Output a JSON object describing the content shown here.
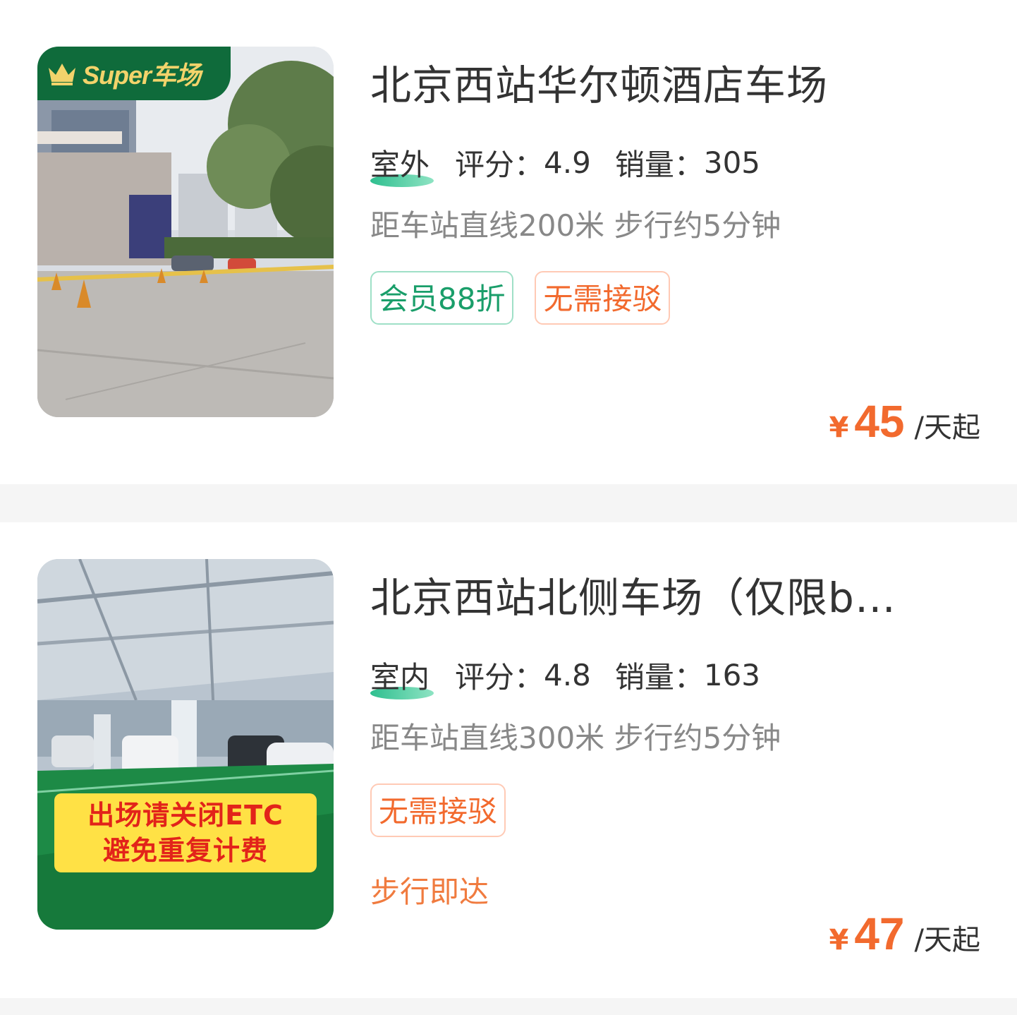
{
  "listings": [
    {
      "badge": "Super车场",
      "title": "北京西站华尔顿酒店车场",
      "environment": "室外",
      "rating_label": "评分：",
      "rating": "4.9",
      "sales_label": "销量：",
      "sales": "305",
      "distance": "距车站直线200米 步行约5分钟",
      "tags": [
        "会员88折",
        "无需接驳"
      ],
      "price_currency": "¥",
      "price": "45",
      "price_unit": "/天起"
    },
    {
      "title": "北京西站北侧车场（仅限b…",
      "image_banner": [
        "出场请关闭ETC",
        "避免重复计费"
      ],
      "environment": "室内",
      "rating_label": "评分：",
      "rating": "4.8",
      "sales_label": "销量：",
      "sales": "163",
      "distance": "距车站直线300米 步行约5分钟",
      "tags": [
        "无需接驳"
      ],
      "walk_note": "步行即达",
      "price_currency": "¥",
      "price": "47",
      "price_unit": "/天起"
    }
  ],
  "colors": {
    "accent_orange": "#f26a2e",
    "accent_green": "#1a9e6a",
    "badge_green": "#0f6b3b"
  }
}
